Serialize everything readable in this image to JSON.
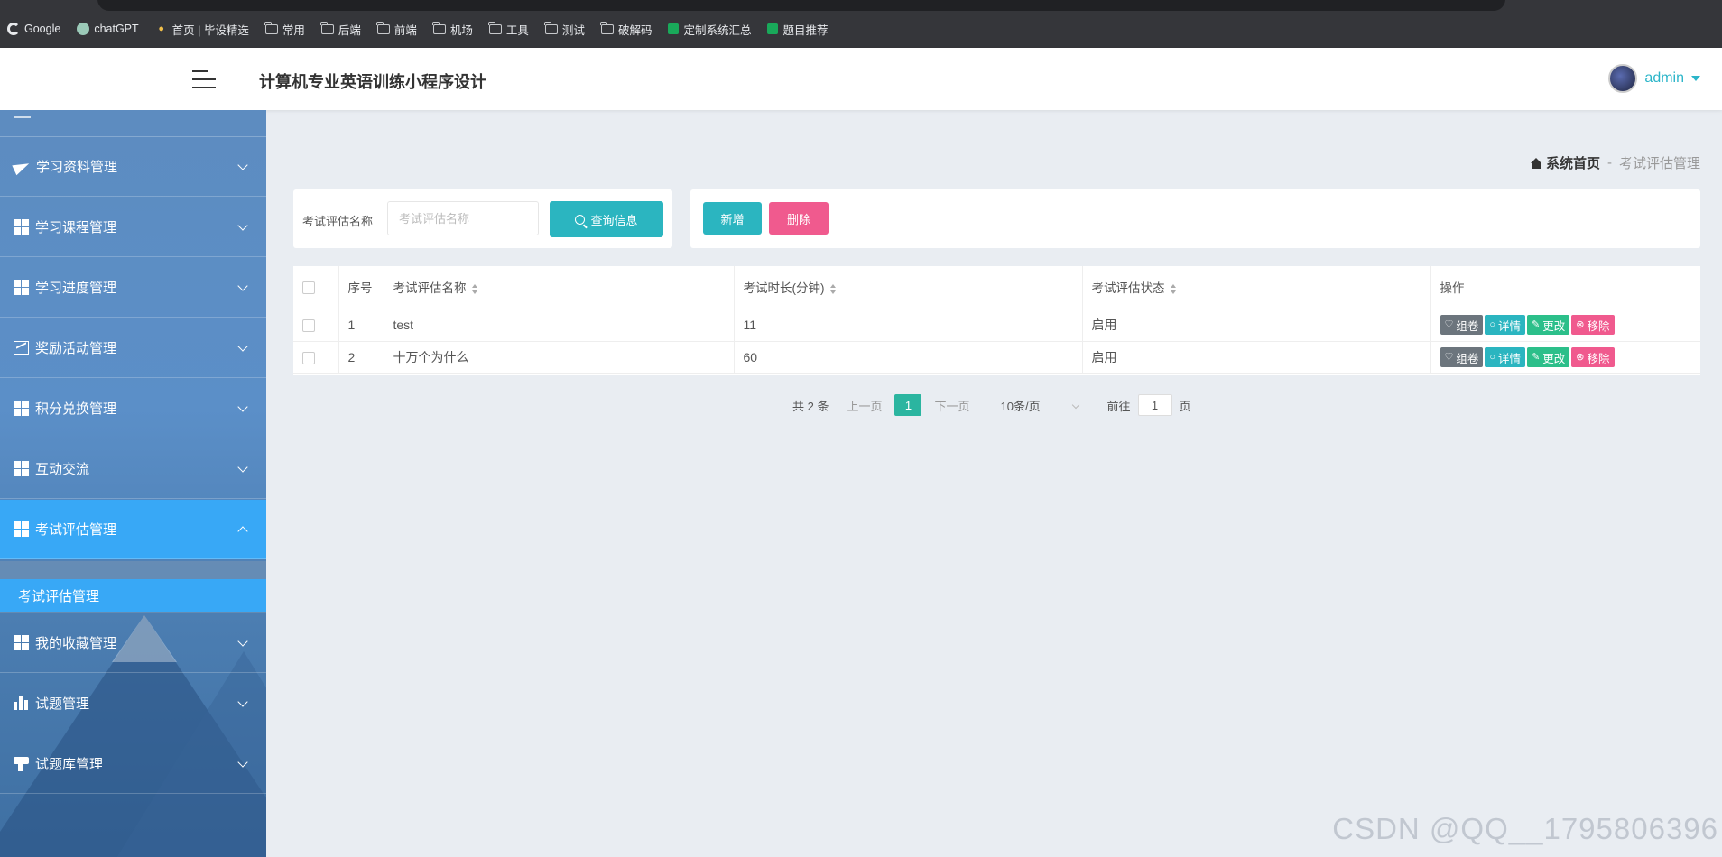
{
  "browser": {
    "bookmarks": [
      {
        "label": "Google",
        "icon": "google-icon"
      },
      {
        "label": "chatGPT",
        "icon": "chatgpt-icon"
      },
      {
        "label": "首页 | 毕设精选",
        "icon": "bulb-icon"
      },
      {
        "label": "常用",
        "icon": "folder-icon"
      },
      {
        "label": "后端",
        "icon": "folder-icon"
      },
      {
        "label": "前端",
        "icon": "folder-icon"
      },
      {
        "label": "机场",
        "icon": "folder-icon"
      },
      {
        "label": "工具",
        "icon": "folder-icon"
      },
      {
        "label": "测试",
        "icon": "folder-icon"
      },
      {
        "label": "破解码",
        "icon": "folder-icon"
      },
      {
        "label": "定制系统汇总",
        "icon": "sheet-icon"
      },
      {
        "label": "题目推荐",
        "icon": "sheet-icon"
      }
    ]
  },
  "header": {
    "title": "计算机专业英语训练小程序设计",
    "user": "admin"
  },
  "sidebar": {
    "items": [
      {
        "label": "学习资料管理",
        "icon": "paper-plane-icon"
      },
      {
        "label": "学习课程管理",
        "icon": "grid-icon"
      },
      {
        "label": "学习进度管理",
        "icon": "grid-icon"
      },
      {
        "label": "奖励活动管理",
        "icon": "line-chart-icon"
      },
      {
        "label": "积分兑换管理",
        "icon": "grid-icon"
      },
      {
        "label": "互动交流",
        "icon": "grid-icon"
      },
      {
        "label": "考试评估管理",
        "icon": "grid-icon",
        "active": true
      },
      {
        "label": "我的收藏管理",
        "icon": "grid-icon"
      },
      {
        "label": "试题管理",
        "icon": "bar-chart-icon"
      },
      {
        "label": "试题库管理",
        "icon": "stamp-icon"
      }
    ],
    "submenu": {
      "label": "考试评估管理"
    }
  },
  "breadcrumb": {
    "home": "系统首页",
    "separator": "-",
    "current": "考试评估管理"
  },
  "search": {
    "label": "考试评估名称",
    "placeholder": "考试评估名称",
    "value": "",
    "button": "查询信息"
  },
  "actions": {
    "add": "新增",
    "delete": "删除"
  },
  "table": {
    "headers": {
      "index": "序号",
      "name": "考试评估名称",
      "duration": "考试时长(分钟)",
      "status": "考试评估状态",
      "ops": "操作"
    },
    "rows": [
      {
        "index": "1",
        "name": "test",
        "duration": "11",
        "status": "启用"
      },
      {
        "index": "2",
        "name": "十万个为什么",
        "duration": "60",
        "status": "启用"
      }
    ],
    "op_labels": {
      "compose": "组卷",
      "detail": "详情",
      "edit": "更改",
      "remove": "移除"
    }
  },
  "pagination": {
    "total": "共 2 条",
    "prev": "上一页",
    "current": "1",
    "next": "下一页",
    "page_size": "10条/页",
    "goto_prefix": "前往",
    "goto_value": "1",
    "goto_suffix": "页"
  },
  "watermark": "CSDN @QQ__1795806396",
  "colors": {
    "accent": "#2bb5c0",
    "danger": "#f05a8e",
    "sidebar_active": "#38a8f6",
    "user_link": "#2bb5c9"
  }
}
